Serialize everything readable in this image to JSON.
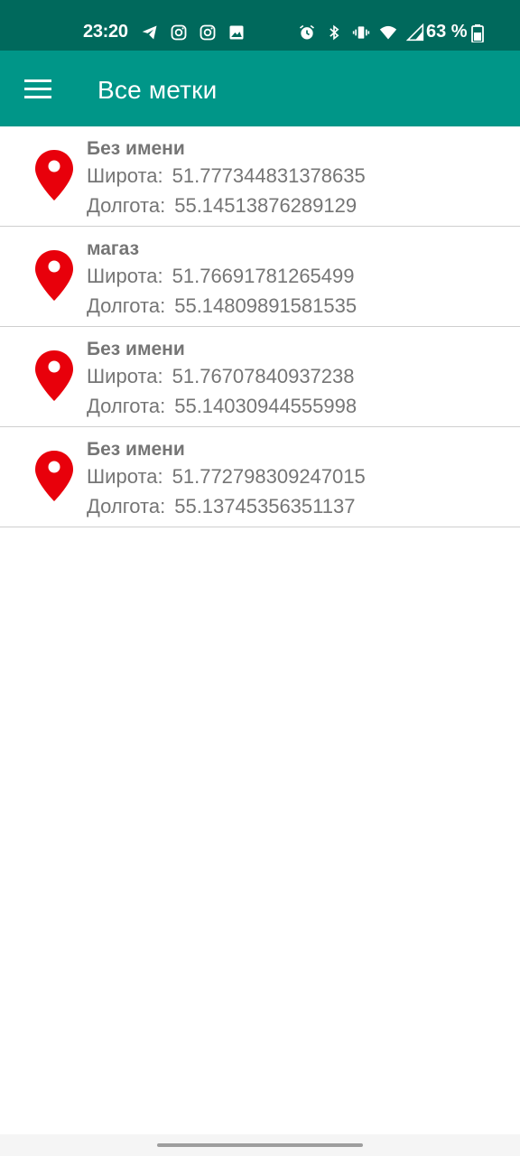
{
  "status_bar": {
    "time": "23:20",
    "battery_text": "63 %",
    "left_icons": [
      "telegram-icon",
      "instagram-icon",
      "instagram-icon",
      "gallery-icon"
    ],
    "right_icons": [
      "alarm-icon",
      "bluetooth-icon",
      "vibrate-icon",
      "wifi-icon",
      "signal-icon",
      "battery-icon"
    ]
  },
  "app_bar": {
    "title": "Все метки",
    "menu_icon": "hamburger-menu-icon",
    "background": "#009688"
  },
  "markers": [
    {
      "name": "Без имени",
      "lat_label": "Широта:",
      "lat": "51.777344831378635",
      "lon_label": "Долгота:",
      "lon": "55.14513876289129"
    },
    {
      "name": "магаз",
      "lat_label": "Широта:",
      "lat": "51.76691781265499",
      "lon_label": "Долгота:",
      "lon": "55.14809891581535"
    },
    {
      "name": "Без имени",
      "lat_label": "Широта:",
      "lat": "51.76707840937238",
      "lon_label": "Долгота:",
      "lon": "55.14030944555998"
    },
    {
      "name": "Без имени",
      "lat_label": "Широта:",
      "lat": "51.772798309247015",
      "lon_label": "Долгота:",
      "lon": "55.13745356351137"
    }
  ],
  "colors": {
    "status_bar": "#00695c",
    "accent": "#009688",
    "pin": "#e8000b",
    "text_secondary": "#757575"
  }
}
